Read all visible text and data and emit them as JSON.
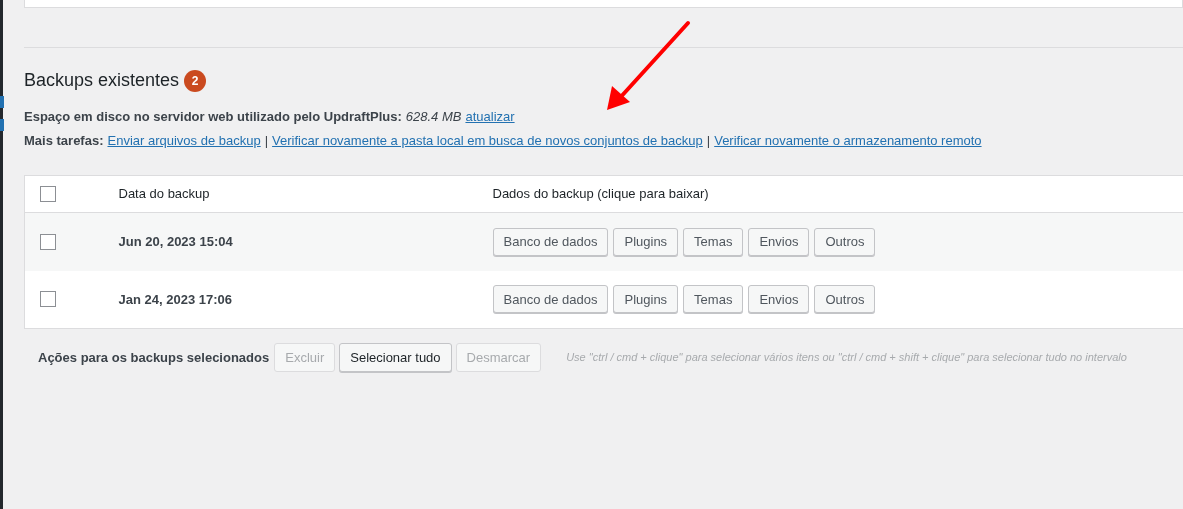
{
  "section": {
    "title": "Backups existentes",
    "count": "2"
  },
  "disk_usage": {
    "label": "Espaço em disco no servidor web utilizado pelo UpdraftPlus:",
    "value": "628.4 MB",
    "link": "atualizar"
  },
  "more_tasks": {
    "label": "Mais tarefas:",
    "links": [
      "Enviar arquivos de backup",
      "Verificar novamente a pasta local em busca de novos conjuntos de backup",
      "Verificar novamente o armazenamento remoto"
    ],
    "separator": "|"
  },
  "table": {
    "select_all": {
      "checked": false
    },
    "columns": [
      "Data do backup",
      "Dados do backup (clique para baixar)"
    ],
    "rows": [
      {
        "checked": false,
        "date": "Jun 20, 2023 15:04",
        "buttons": [
          "Banco de dados",
          "Plugins",
          "Temas",
          "Envios",
          "Outros"
        ]
      },
      {
        "checked": false,
        "date": "Jan 24, 2023 17:06",
        "buttons": [
          "Banco de dados",
          "Plugins",
          "Temas",
          "Envios",
          "Outros"
        ]
      }
    ]
  },
  "actions": {
    "label": "Ações para os backups selecionados",
    "buttons": [
      {
        "label": "Excluir",
        "disabled": true
      },
      {
        "label": "Selecionar tudo",
        "disabled": false
      },
      {
        "label": "Desmarcar",
        "disabled": true
      }
    ],
    "hint": "Use \"ctrl / cmd + clique\" para selecionar vários itens ou \"ctrl / cmd + shift + clique\" para selecionar tudo no intervalo"
  }
}
